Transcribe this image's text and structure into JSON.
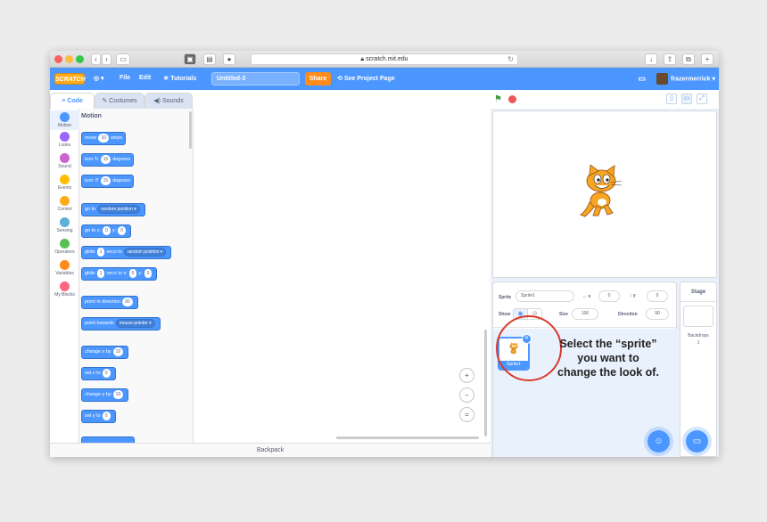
{
  "browser": {
    "url": "scratch.mit.edu",
    "icons": [
      "back-icon",
      "forward-icon",
      "sidebar-icon",
      "reload-icon",
      "download-icon",
      "share-icon",
      "tabs-icon"
    ]
  },
  "menubar": {
    "logo": "SCRATCH",
    "file": "File",
    "edit": "Edit",
    "tutorials": "Tutorials",
    "project_title": "Untitled-3",
    "share": "Share",
    "see_project": "See Project Page",
    "username": "frazermerrick",
    "accent": "#4c97ff"
  },
  "tabs": {
    "code": "Code",
    "costumes": "Costumes",
    "sounds": "Sounds"
  },
  "categories": [
    {
      "label": "Motion",
      "color": "#4c97ff"
    },
    {
      "label": "Looks",
      "color": "#9966ff"
    },
    {
      "label": "Sound",
      "color": "#cf63cf"
    },
    {
      "label": "Events",
      "color": "#ffbf00"
    },
    {
      "label": "Control",
      "color": "#ffab19"
    },
    {
      "label": "Sensing",
      "color": "#5cb1d6"
    },
    {
      "label": "Operators",
      "color": "#59c059"
    },
    {
      "label": "Variables",
      "color": "#ff8c1a"
    },
    {
      "label": "My Blocks",
      "color": "#ff6680"
    }
  ],
  "palette": {
    "title": "Motion",
    "move": {
      "a": "move",
      "v": "10",
      "b": "steps"
    },
    "turn_right": {
      "a": "turn",
      "icon": "↻",
      "v": "15",
      "b": "degrees"
    },
    "turn_left": {
      "a": "turn",
      "icon": "↺",
      "v": "15",
      "b": "degrees"
    },
    "goto": {
      "a": "go to",
      "dd": "random position"
    },
    "gotoxy": {
      "a": "go to x:",
      "x": "0",
      "b": "y:",
      "y": "0"
    },
    "glide_to": {
      "a": "glide",
      "v": "1",
      "b": "secs to",
      "dd": "random position"
    },
    "glide_xy": {
      "a": "glide",
      "v": "1",
      "b": "secs to x:",
      "x": "0",
      "c": "y:",
      "y": "0"
    },
    "point_dir": {
      "a": "point in direction",
      "v": "90"
    },
    "point_towards": {
      "a": "point towards",
      "dd": "mouse-pointer"
    },
    "change_x": {
      "a": "change x by",
      "v": "10"
    },
    "set_x": {
      "a": "set x to",
      "v": "0"
    },
    "change_y": {
      "a": "change y by",
      "v": "10"
    },
    "set_y": {
      "a": "set y to",
      "v": "0"
    }
  },
  "script": {
    "zoom_in": "+",
    "zoom_out": "−",
    "zoom_reset": "="
  },
  "backpack": "Backpack",
  "sprite_info": {
    "sprite_label": "Sprite",
    "sprite_name": "Sprite1",
    "x_label": "x",
    "x": "0",
    "y_label": "y",
    "y": "0",
    "show_label": "Show",
    "size_label": "Size",
    "size": "100",
    "direction_label": "Direction",
    "direction": "90"
  },
  "sprites": [
    {
      "name": "Sprite1"
    }
  ],
  "annotation": {
    "line1": "Select the “sprite”",
    "line2": "you want to",
    "line3": "change the look of."
  },
  "stage_pane": {
    "title": "Stage",
    "backdrops_label": "Backdrops",
    "backdrops_count": "1"
  }
}
